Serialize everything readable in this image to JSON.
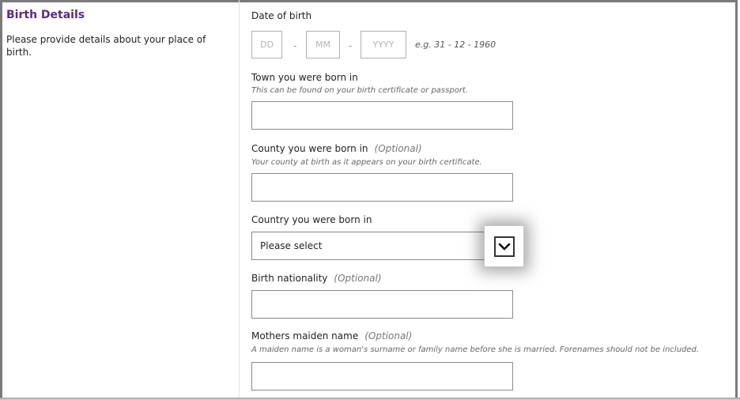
{
  "section": {
    "title": "Birth Details",
    "description": "Please provide details about your place of birth."
  },
  "dob": {
    "label": "Date of birth",
    "day_placeholder": "DD",
    "month_placeholder": "MM",
    "year_placeholder": "YYYY",
    "separator": "-",
    "example": "e.g. 31 - 12 - 1960"
  },
  "town": {
    "label": "Town you were born in",
    "hint": "This can be found on your birth certificate or passport.",
    "value": ""
  },
  "county": {
    "label": "County you were born in",
    "optional": "(Optional)",
    "hint": "Your county at birth as it appears on your birth certificate.",
    "value": ""
  },
  "country": {
    "label": "Country you were born in",
    "selected": "Please select",
    "icon": "chevron-down-icon"
  },
  "nationality": {
    "label": "Birth nationality",
    "optional": "(Optional)",
    "value": ""
  },
  "maiden": {
    "label": "Mothers maiden name",
    "optional": "(Optional)",
    "hint": "A maiden name is a woman's surname or family name before she is married. Forenames should not be included.",
    "value": ""
  },
  "colors": {
    "title": "#5b2a86",
    "border": "#8a8a8a"
  }
}
